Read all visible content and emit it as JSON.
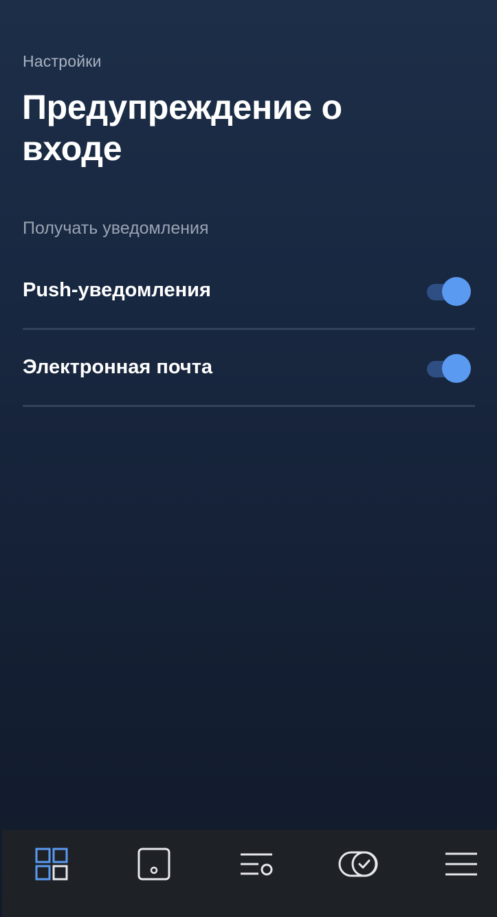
{
  "header": {
    "breadcrumb": "Настройки",
    "title": "Предупреждение о входе"
  },
  "section": {
    "label": "Получать уведомления"
  },
  "settings": [
    {
      "label": "Push-уведомления",
      "enabled": true
    },
    {
      "label": "Электронная почта",
      "enabled": true
    }
  ],
  "bottom_nav": {
    "items": [
      {
        "icon": "dashboard-grid-icon",
        "active": true
      },
      {
        "icon": "device-icon",
        "active": false
      },
      {
        "icon": "list-settings-icon",
        "active": false
      },
      {
        "icon": "toggle-check-icon",
        "active": false
      },
      {
        "icon": "menu-icon",
        "active": false
      }
    ]
  },
  "colors": {
    "accent": "#5a9af0",
    "background_top": "#1d2e48",
    "background_bottom": "#111a2a",
    "nav_background": "#1e2126",
    "icon_inactive": "#e6e8ec"
  }
}
